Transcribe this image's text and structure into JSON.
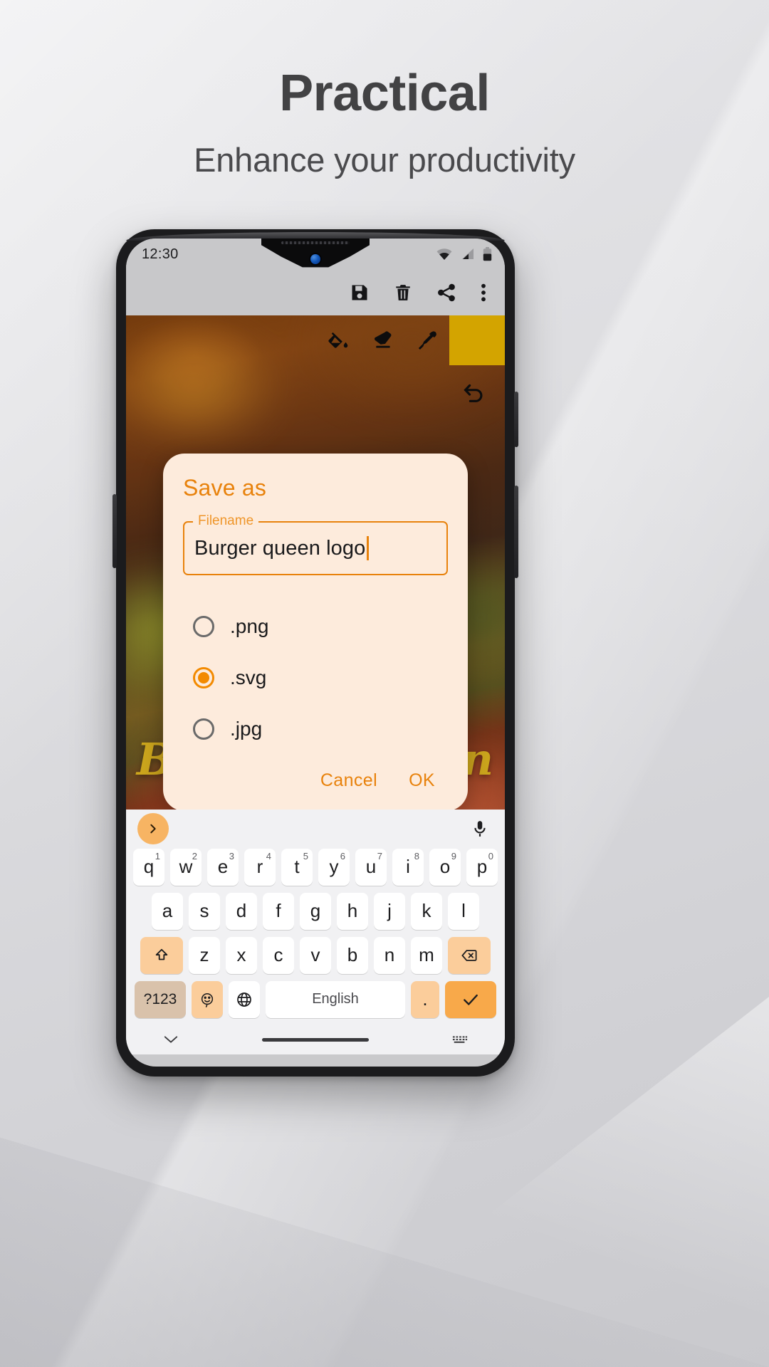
{
  "promo": {
    "title": "Practical",
    "subtitle": "Enhance your productivity"
  },
  "phone": {
    "status_bar": {
      "clock": "12:30",
      "icons": [
        "wifi-icon",
        "cell-signal-icon",
        "battery-icon"
      ]
    },
    "app_bar": {
      "actions": [
        {
          "name": "save-icon",
          "label": "Save"
        },
        {
          "name": "delete-icon",
          "label": "Delete"
        },
        {
          "name": "share-icon",
          "label": "Share"
        },
        {
          "name": "overflow-menu-icon",
          "label": "More options"
        }
      ]
    },
    "canvas": {
      "tools": [
        {
          "name": "fill-bucket-icon",
          "label": "Fill"
        },
        {
          "name": "eraser-icon",
          "label": "Eraser"
        },
        {
          "name": "eyedropper-icon",
          "label": "Color picker"
        }
      ],
      "current_color": "#d8a800",
      "undo_label": "Undo",
      "logo_text": "Burger Queen"
    },
    "dialog": {
      "title": "Save as",
      "field_label": "Filename",
      "field_value": "Burger queen logo",
      "field_placeholder": "Filename",
      "options": [
        {
          "label": ".png",
          "selected": false
        },
        {
          "label": ".svg",
          "selected": true
        },
        {
          "label": ".jpg",
          "selected": false
        }
      ],
      "cancel_label": "Cancel",
      "ok_label": "OK",
      "accent_color": "#e8820c",
      "surface_color": "#fdebdc"
    },
    "keyboard": {
      "expand_icon": "chevron-right-icon",
      "mic_icon": "microphone-icon",
      "row1": [
        {
          "k": "q",
          "n": "1"
        },
        {
          "k": "w",
          "n": "2"
        },
        {
          "k": "e",
          "n": "3"
        },
        {
          "k": "r",
          "n": "4"
        },
        {
          "k": "t",
          "n": "5"
        },
        {
          "k": "y",
          "n": "6"
        },
        {
          "k": "u",
          "n": "7"
        },
        {
          "k": "i",
          "n": "8"
        },
        {
          "k": "o",
          "n": "9"
        },
        {
          "k": "p",
          "n": "0"
        }
      ],
      "row2": [
        "a",
        "s",
        "d",
        "f",
        "g",
        "h",
        "j",
        "k",
        "l"
      ],
      "row3": [
        "z",
        "x",
        "c",
        "v",
        "b",
        "n",
        "m"
      ],
      "shift_icon": "shift-icon",
      "backspace_icon": "backspace-icon",
      "symbols_label": "?123",
      "emoji_icon": "emoji-icon",
      "language_icon": "globe-icon",
      "space_label": "English",
      "period_label": ".",
      "enter_icon": "check-icon",
      "hide_keyboard_icon": "chevron-down-icon",
      "keyboard_switch_icon": "keyboard-icon"
    }
  }
}
